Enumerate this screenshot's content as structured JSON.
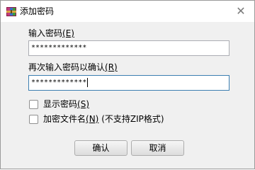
{
  "window": {
    "title": "添加密码",
    "close_symbol": "✕"
  },
  "form": {
    "password_label": "输入密码",
    "password_mnemonic": "(E)",
    "password_value": "*************",
    "confirm_label": "再次输入密码以确认",
    "confirm_mnemonic": "(R)",
    "confirm_value": "*************"
  },
  "options": {
    "show_password_label": "显示密码",
    "show_password_mnemonic": "(S)",
    "show_password_checked": false,
    "encrypt_filenames_label": "加密文件名",
    "encrypt_filenames_mnemonic": "(N)",
    "encrypt_filenames_note": "(不支持ZIP格式)",
    "encrypt_filenames_checked": false
  },
  "buttons": {
    "ok": "确认",
    "cancel": "取消"
  },
  "colors": {
    "titlebar": "#ffffff",
    "dialog_bg": "#f0f0f0",
    "field_border": "#abadb3",
    "focus_border": "#3c7fb1"
  },
  "icons": {
    "app_icon": "archive-app-icon",
    "close_icon": "close-icon"
  }
}
